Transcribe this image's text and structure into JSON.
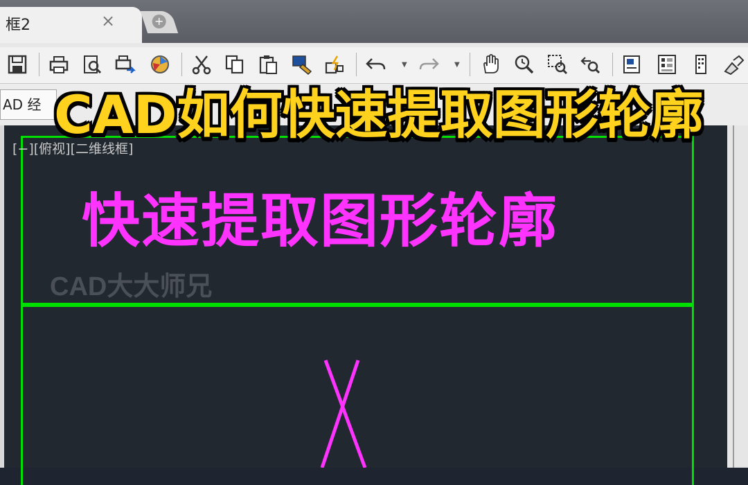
{
  "tab": {
    "label": "框2",
    "close": "×",
    "new_tab": "+"
  },
  "toolbar": {
    "buttons": [
      "save-icon",
      "print-icon",
      "print-preview-icon",
      "publish-icon",
      "3d-dwf-icon",
      "cut-icon",
      "copy-icon",
      "paste-icon",
      "match-properties-icon",
      "block-editor-icon",
      "undo-icon",
      "redo-icon",
      "pan-icon",
      "zoom-realtime-icon",
      "zoom-window-icon",
      "zoom-previous-icon",
      "properties-icon",
      "design-center-icon",
      "tool-palettes-icon",
      "markup-icon"
    ]
  },
  "secondbar": {
    "workspace_label": "AD 经"
  },
  "headline": "CAD如何快速提取图形轮廓",
  "viewport": {
    "label": "[−][俯视][二维线框]"
  },
  "drawing": {
    "text": "快速提取图形轮廓",
    "watermark": "CAD大大师兄"
  },
  "colors": {
    "frame": "#00e000",
    "text": "#ff33ff",
    "headline": "#ffd21e",
    "canvas": "#212830"
  }
}
